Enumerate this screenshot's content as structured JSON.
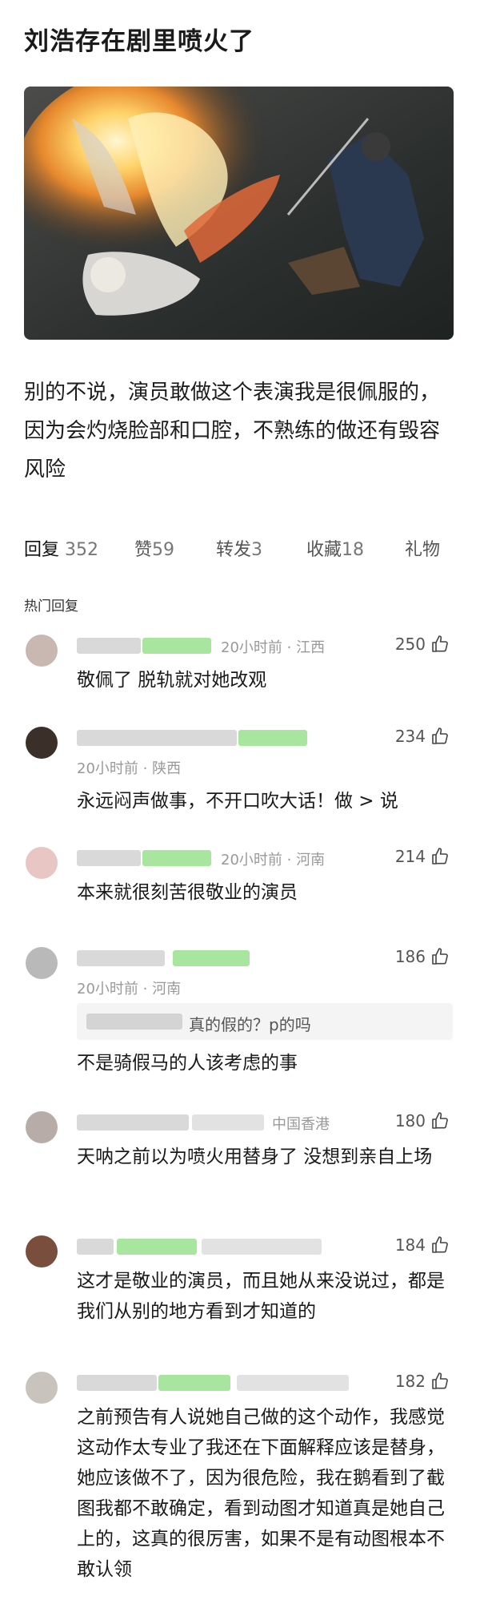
{
  "post": {
    "title": "刘浩存在剧里喷火了",
    "body": "别的不说，演员敢做这个表演我是很佩服的，因为会灼烧脸部和口腔，不熟练的做还有毁容风险"
  },
  "tabs": [
    {
      "label": "回复",
      "count": "352"
    },
    {
      "label": "赞",
      "count": "59"
    },
    {
      "label": "转发",
      "count": "3"
    },
    {
      "label": "收藏",
      "count": "18"
    },
    {
      "label": "礼物",
      "count": ""
    }
  ],
  "hot_label": "热门回复",
  "comments": [
    {
      "time": "20小时前",
      "location": "江西",
      "likes": "250",
      "text": "敬佩了 脱轨就对她改观"
    },
    {
      "time": "20小时前",
      "location": "陕西",
      "likes": "234",
      "text": "永远闷声做事，不开口吹大话！做 > 说"
    },
    {
      "time": "20小时前",
      "location": "河南",
      "likes": "214",
      "text": "本来就很刻苦很敬业的演员"
    },
    {
      "time": "20小时前",
      "location": "河南",
      "likes": "186",
      "quote": "真的假的？p的吗",
      "text": "不是骑假马的人该考虑的事"
    },
    {
      "time": "",
      "location": "中国香港",
      "likes": "180",
      "text": "天呐之前以为喷火用替身了 没想到亲自上场"
    },
    {
      "time": "",
      "location": "",
      "likes": "184",
      "text": "这才是敬业的演员，而且她从来没说过，都是我们从别的地方看到才知道的"
    },
    {
      "time": "",
      "location": "",
      "likes": "182",
      "text": "之前预告有人说她自己做的这个动作，我感觉这动作太专业了我还在下面解释应该是替身，她应该做不了，因为很危险，我在鹅看到了截图我都不敢确定，看到动图才知道真是她自己上的，这真的很厉害，如果不是有动图根本不敢认领"
    }
  ],
  "colors": {
    "tag_green": "#a8e6a0",
    "blur_gray": "#d9d9d9",
    "meta_gray": "#999999"
  },
  "icons": {
    "like": "thumbs-up-icon"
  }
}
